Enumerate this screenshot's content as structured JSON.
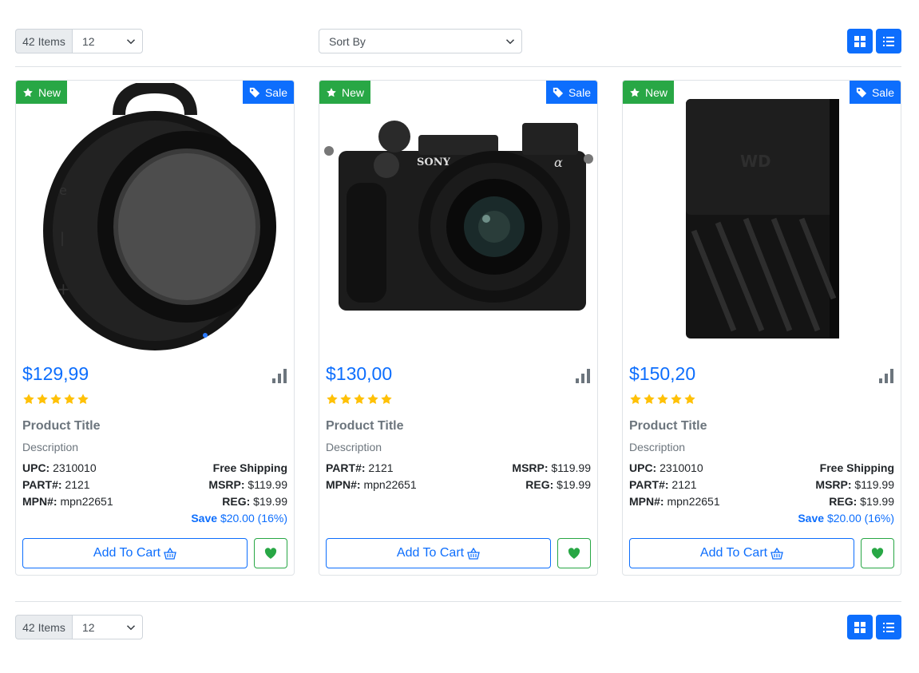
{
  "toolbar": {
    "items_label": "42 Items",
    "per_page": "12",
    "sort_by": "Sort By"
  },
  "colors": {
    "primary": "#0d6efd",
    "success": "#28a745",
    "star": "#ffc107",
    "muted": "#6c757d"
  },
  "products": [
    {
      "badge_new": "New",
      "badge_sale": "Sale",
      "image_icon": "speaker-image",
      "price": "$129,99",
      "rating": 5,
      "title": "Product Title",
      "description": "Description",
      "upc_label": "UPC:",
      "upc": "2310010",
      "part_label": "PART#:",
      "part": "2121",
      "mpn_label": "MPN#:",
      "mpn": "mpn22651",
      "shipping": "Free Shipping",
      "msrp_label": "MSRP:",
      "msrp": "$119.99",
      "reg_label": "REG:",
      "reg": "$19.99",
      "save_label": "Save",
      "save": "$20.00 (16%)",
      "cart_label": "Add To Cart"
    },
    {
      "badge_new": "New",
      "badge_sale": "Sale",
      "image_icon": "camera-image",
      "price": "$130,00",
      "rating": 5,
      "title": "Product Title",
      "description": "Description",
      "part_label": "PART#:",
      "part": "2121",
      "mpn_label": "MPN#:",
      "mpn": "mpn22651",
      "msrp_label": "MSRP:",
      "msrp": "$119.99",
      "reg_label": "REG:",
      "reg": "$19.99",
      "cart_label": "Add To Cart"
    },
    {
      "badge_new": "New",
      "badge_sale": "Sale",
      "image_icon": "hard-drive-image",
      "price": "$150,20",
      "rating": 5,
      "title": "Product Title",
      "description": "Description",
      "upc_label": "UPC:",
      "upc": "2310010",
      "part_label": "PART#:",
      "part": "2121",
      "mpn_label": "MPN#:",
      "mpn": "mpn22651",
      "shipping": "Free Shipping",
      "msrp_label": "MSRP:",
      "msrp": "$119.99",
      "reg_label": "REG:",
      "reg": "$19.99",
      "save_label": "Save",
      "save": "$20.00 (16%)",
      "cart_label": "Add To Cart"
    }
  ]
}
